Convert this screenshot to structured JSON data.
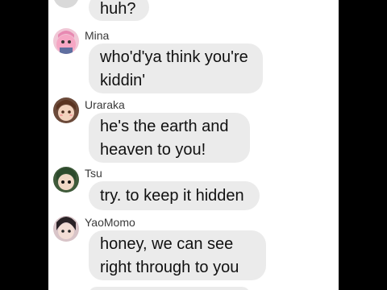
{
  "chat": {
    "messages": [
      {
        "sender": "",
        "text": "huh?",
        "avatar": "avatar-icon-partial"
      },
      {
        "sender": "Mina",
        "text": "who'd'ya think you're\nkiddin'",
        "avatar": "avatar-icon-mina"
      },
      {
        "sender": "Uraraka",
        "text": "he's the earth and\nheaven to you!",
        "avatar": "avatar-icon-uraraka"
      },
      {
        "sender": "Tsu",
        "text": "try. to keep it hidden",
        "avatar": "avatar-icon-tsu"
      },
      {
        "sender": "YaoMomo",
        "text": "honey, we can see\nright through to you",
        "avatar": "avatar-icon-yaomomo"
      }
    ]
  },
  "colors": {
    "bubble": "#ebebeb",
    "background": "#ffffff",
    "letterbox": "#000000"
  }
}
